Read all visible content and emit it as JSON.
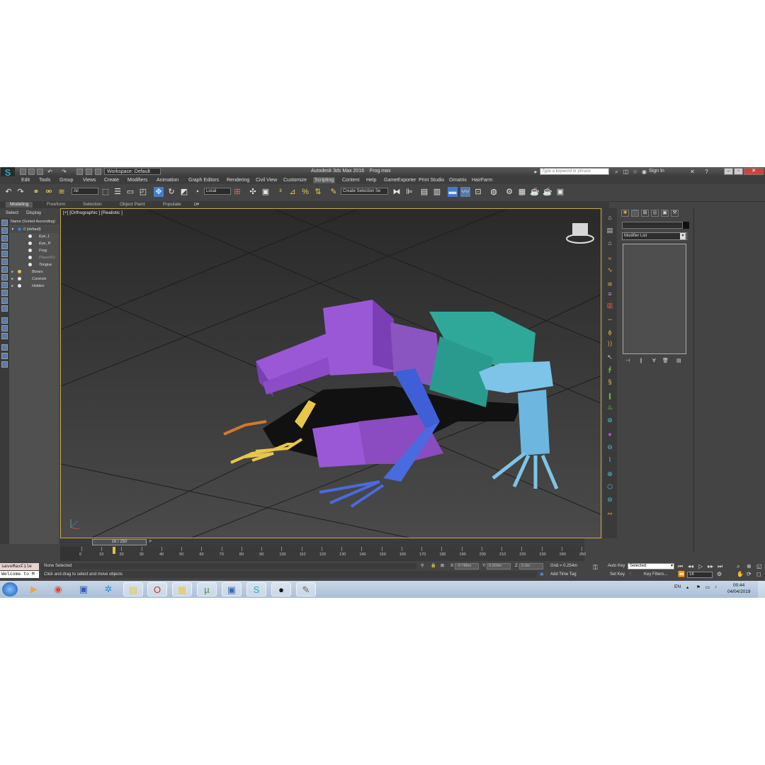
{
  "titlebar": {
    "app_title": "Autodesk 3ds Max 2016",
    "file_name": "Frog.max",
    "workspace": "Workspace: Default",
    "search_placeholder": "Type a keyword or phrase",
    "sign_in": "Sign In",
    "logo": "MAX"
  },
  "menu": [
    "Edit",
    "Tools",
    "Group",
    "Views",
    "Create",
    "Modifiers",
    "Animation",
    "Graph Editors",
    "Rendering",
    "Civil View",
    "Customize",
    "Scripting",
    "Content",
    "Help",
    "GameExporter",
    "Print Studio",
    "Ornatrix",
    "HairFarm"
  ],
  "menu_active": "Scripting",
  "toolbar": {
    "filter": "All",
    "ref_coord": "Local",
    "selection_set": "Create Selection Se"
  },
  "ribbon": [
    "Modeling",
    "Freeform",
    "Selection",
    "Object Paint",
    "Populate"
  ],
  "explorer": {
    "tabs": [
      "Select",
      "Display"
    ],
    "header": "Name (Sorted Ascending)",
    "items": [
      {
        "label": "0 (default)"
      },
      {
        "label": "Eye_L"
      },
      {
        "label": "Eye_R"
      },
      {
        "label": "Frog"
      },
      {
        "label": "Plane001"
      },
      {
        "label": "Tongue"
      },
      {
        "label": "Bones"
      },
      {
        "label": "Controls"
      },
      {
        "label": "Hidden"
      }
    ]
  },
  "viewport": {
    "label": "[+] [Orthographic ] [Realistic ]"
  },
  "command_panel": {
    "modifier_list": "Modifier List"
  },
  "timeline": {
    "frame": "16 / 250",
    "ticks": [
      "0",
      "10",
      "20",
      "30",
      "40",
      "50",
      "60",
      "70",
      "80",
      "90",
      "100",
      "110",
      "120",
      "130",
      "140",
      "150",
      "160",
      "170",
      "180",
      "190",
      "200",
      "210",
      "220",
      "230",
      "240",
      "250"
    ]
  },
  "status": {
    "maxscript_line1": "saveMaxFile",
    "maxscript_line2": "Welcome to M",
    "selection": "None Selected",
    "prompt": "Click and drag to select and move objects",
    "x_label": "X:",
    "x": "-0.788m",
    "y_label": "Y:",
    "y": "0.009m",
    "z_label": "Z:",
    "z": "0.0m",
    "grid": "Grid = 0.254m",
    "add_time_tag": "Add Time Tag",
    "auto_key": "Auto Key",
    "set_key": "Set Key",
    "key_mode": "Selected",
    "key_filters": "Key Filters...",
    "current_frame": "16"
  },
  "taskbar": {
    "language": "EN",
    "time": "00:44",
    "date": "04/04/2019"
  }
}
